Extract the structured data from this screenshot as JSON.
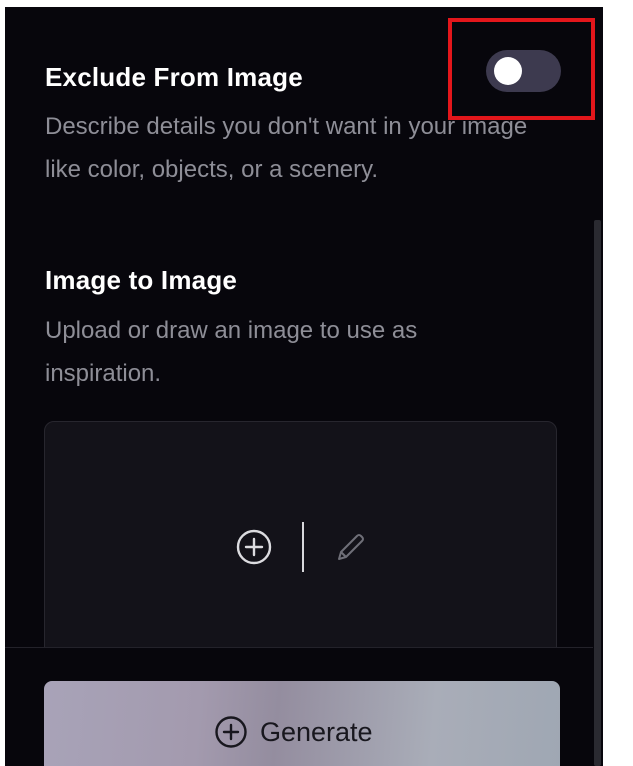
{
  "exclude_section": {
    "title": "Exclude From Image",
    "description": "Describe details you don't want in your image like color, objects, or a scenery.",
    "toggle_state": "off"
  },
  "img2img_section": {
    "title": "Image to Image",
    "description": "Upload or draw an image to use as inspiration.",
    "upload_icon": "plus-circle-icon",
    "draw_icon": "pencil-icon"
  },
  "footer": {
    "generate_label": "Generate",
    "generate_icon": "plus-circle-icon"
  },
  "colors": {
    "panel_background": "#07060c",
    "toggle_track": "#3d3a4f",
    "highlight_annotation": "#e3161b",
    "description_text": "#8e8e97"
  }
}
